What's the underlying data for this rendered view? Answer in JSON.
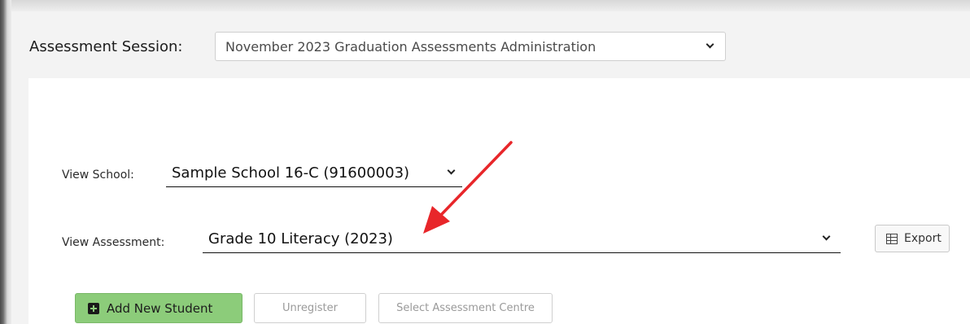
{
  "session": {
    "label": "Assessment Session:",
    "selected": "November 2023 Graduation Assessments Administration"
  },
  "filters": {
    "school_label": "View School:",
    "school_selected": "Sample School 16-C (91600003)",
    "assessment_label": "View Assessment:",
    "assessment_selected": "Grade 10 Literacy (2023)"
  },
  "actions": {
    "export_label": "Export",
    "add_student_label": "Add New Student",
    "unregister_label": "Unregister",
    "select_centre_label": "Select Assessment Centre"
  },
  "colors": {
    "annotation_arrow": "#e8262a",
    "add_button": "#8ccc7a"
  }
}
